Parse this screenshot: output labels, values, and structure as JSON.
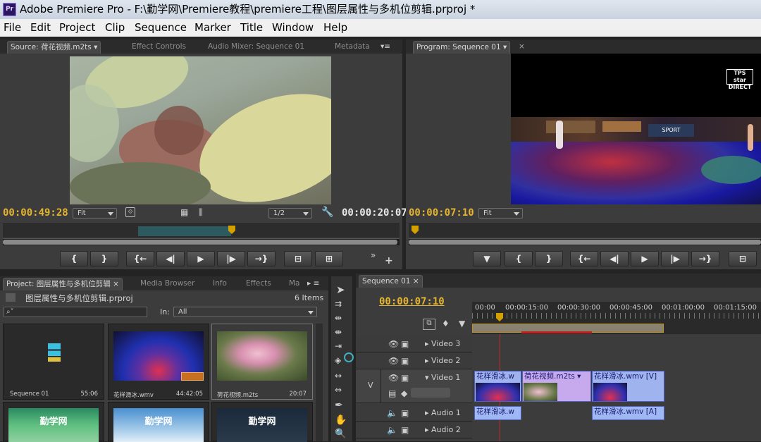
{
  "window": {
    "title": "Adobe Premiere Pro - F:\\勤学网\\Premiere教程\\premiere工程\\图层属性与多机位剪辑.prproj *",
    "app_icon": "Pr"
  },
  "menu": [
    "File",
    "Edit",
    "Project",
    "Clip",
    "Sequence",
    "Marker",
    "Title",
    "Window",
    "Help"
  ],
  "source": {
    "tabs": [
      "Source: 荷花视频.m2ts",
      "Effect Controls",
      "Audio Mixer: Sequence 01",
      "Metadata"
    ],
    "timecode_current": "00:00:49:28",
    "zoom": "Fit",
    "resolution": "1/2",
    "duration": "00:00:20:07"
  },
  "program": {
    "tab": "Program: Sequence 01",
    "timecode": "00:00:07:10",
    "zoom": "Fit",
    "overlay_logo": "TPS star DIRECT"
  },
  "transport_labels": {
    "mark_in": "{",
    "mark_out": "}",
    "goto_in": "{←",
    "step_back": "◀|",
    "play": "▶",
    "step_fwd": "|▶",
    "goto_out": "→}",
    "add_marker": "▼"
  },
  "project": {
    "tabs": [
      "Project: 图层属性与多机位剪辑",
      "Media Browser",
      "Info",
      "Effects",
      "Ma"
    ],
    "file": "图层属性与多机位剪辑.prproj",
    "items_count": "6 Items",
    "in_label": "In:",
    "in_value": "All",
    "search_placeholder": "⌕˅",
    "items": [
      {
        "name": "Sequence 01",
        "duration": "55:06"
      },
      {
        "name": "花样滑冰.wmv",
        "duration": "44:42:05"
      },
      {
        "name": "荷花视频.m2ts",
        "duration": "20:07"
      },
      {
        "name": "勤学网",
        "duration": ""
      },
      {
        "name": "勤学网",
        "duration": ""
      },
      {
        "name": "勤学网",
        "duration": ""
      }
    ]
  },
  "timeline": {
    "tab": "Sequence 01",
    "timecode": "00:00:07:10",
    "ruler": [
      "00:00",
      "00:00:15:00",
      "00:00:30:00",
      "00:00:45:00",
      "00:01:00:00",
      "00:01:15:00"
    ],
    "tracks": [
      {
        "name": "Video 3"
      },
      {
        "name": "Video 2"
      },
      {
        "name": "Video 1"
      },
      {
        "name": "Audio 1"
      },
      {
        "name": "Audio 2"
      }
    ],
    "target_v": "V",
    "clips": {
      "v1": [
        {
          "label": "花样滑冰.w"
        },
        {
          "label": "荷花视频.m2ts"
        },
        {
          "label": "花样滑冰.wmv [V]"
        }
      ],
      "a1": [
        {
          "label": "花样滑冰.w"
        },
        {
          "label": "花样滑冰.wmv [A]"
        }
      ]
    }
  },
  "colors": {
    "timecode": "#e4b430",
    "clip_video": "#9fb3ee",
    "clip_pink": "#c7a9ee",
    "accent_playhead": "#d4a000"
  }
}
